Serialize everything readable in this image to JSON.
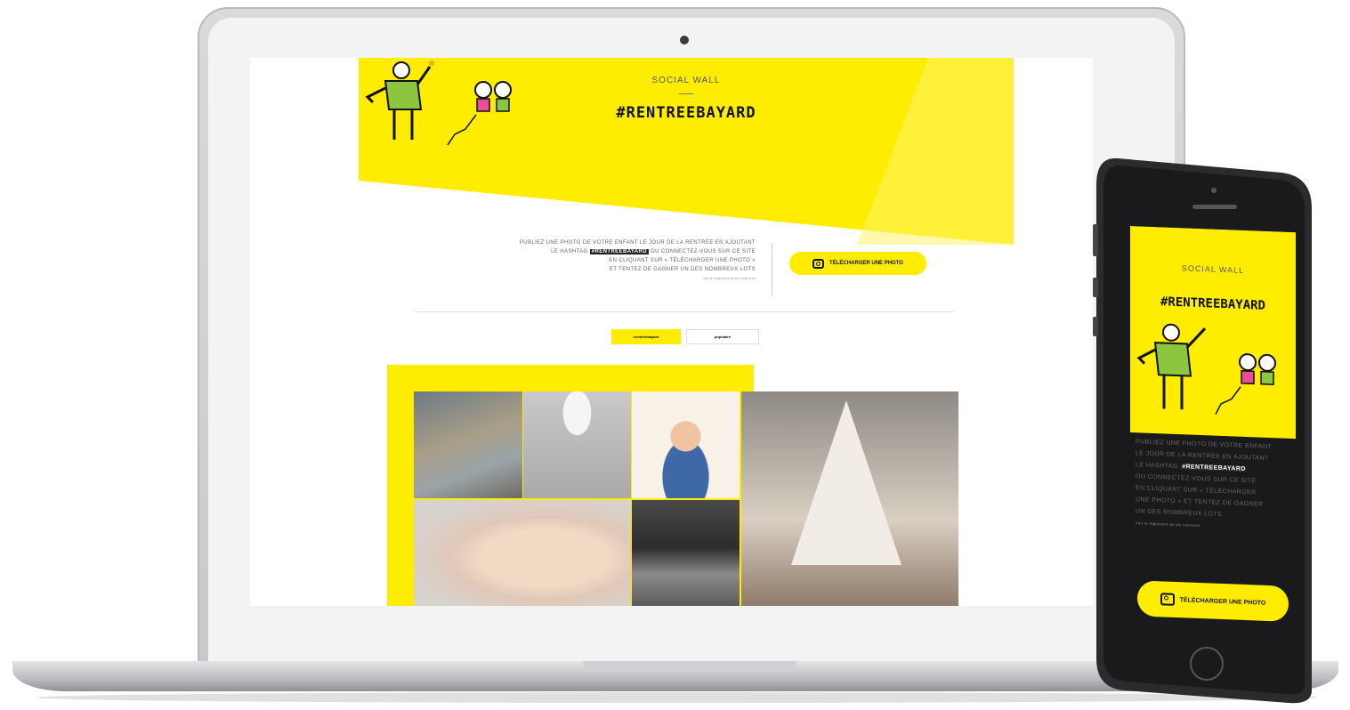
{
  "colors": {
    "accent": "#ffed00",
    "text_dark": "#111111",
    "text_muted": "#666666"
  },
  "desktop": {
    "hero": {
      "label": "SOCIAL WALL",
      "hashtag": "#RENTREEBAYARD"
    },
    "intro": {
      "line1": "PUBLIEZ UNE PHOTO DE VOTRE ENFANT LE JOUR DE LA RENTRÉE EN AJOUTANT",
      "line2_pre": "LE HASHTAG",
      "line2_highlight": "#RENTREEBAYARD",
      "line2_post": "OU CONNECTEZ-VOUS SUR CE SITE",
      "line3": "EN CLIQUANT SUR « TÉLÉCHARGER UNE PHOTO »",
      "line4": "ET TENTEZ DE GAGNER UN DES NOMBREUX LOTS",
      "small": "Voir le règlement du jeu concours"
    },
    "upload_button": {
      "label": "TÉLÉCHARGER UNE PHOTO",
      "icon": "camera-icon"
    },
    "filters": [
      {
        "label": "#rentreebayard"
      },
      {
        "label": "populaire"
      }
    ]
  },
  "mobile": {
    "hero": {
      "label": "SOCIAL WALL",
      "hashtag": "#RENTREEBAYARD"
    },
    "intro": {
      "line1": "PUBLIEZ UNE PHOTO DE VOTRE ENFANT",
      "line2": "LE JOUR DE LA RENTRÉE EN AJOUTANT",
      "line3_pre": "LE HASHTAG",
      "line3_highlight": "#RENTREEBAYARD",
      "line4": "OU CONNECTEZ-VOUS SUR CE SITE",
      "line5": "EN CLIQUANT SUR « TÉLÉCHARGER",
      "line6": "UNE PHOTO » ET TENTEZ DE GAGNER",
      "line7": "UN DES NOMBREUX LOTS",
      "small": "Voir le règlement du jeu concours"
    },
    "upload_button": {
      "label": "TÉLÉCHARGER UNE PHOTO",
      "icon": "camera-icon"
    }
  }
}
